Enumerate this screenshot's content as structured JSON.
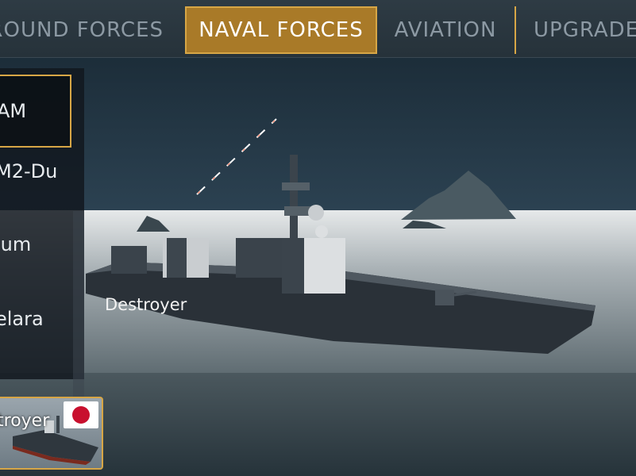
{
  "tabs": [
    {
      "label": "GROUND FORCES",
      "active": false
    },
    {
      "label": "NAVAL FORCES",
      "active": true
    },
    {
      "label": "AVIATION",
      "active": false
    },
    {
      "label": "UPGRADES",
      "active": false
    }
  ],
  "unit_list": [
    {
      "label": "AM",
      "selected": true
    },
    {
      "label": "M2-Du",
      "selected": false
    },
    {
      "label": "ium",
      "selected": false
    },
    {
      "label": "elara",
      "selected": false
    }
  ],
  "ship_label": "Destroyer",
  "ship_card": {
    "label": "troyer",
    "flag_icon": "japan-flag-icon"
  },
  "colors": {
    "accent": "#d7a646",
    "active_tab": "#a97a28"
  }
}
